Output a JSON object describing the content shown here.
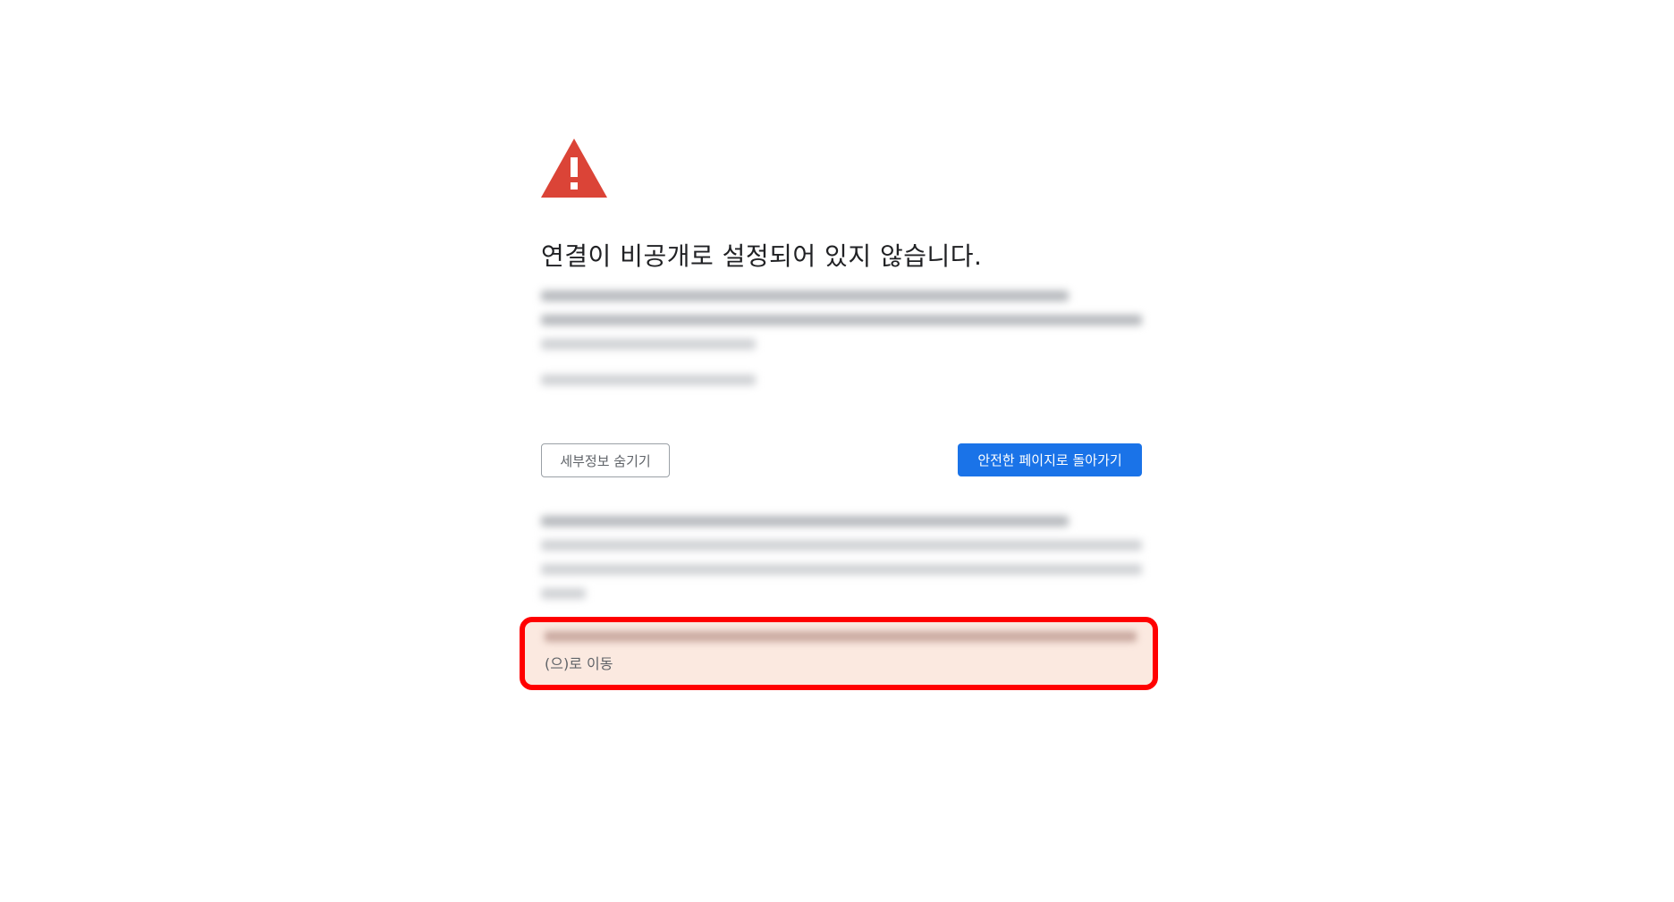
{
  "headline": "연결이 비공개로 설정되어 있지 않습니다.",
  "buttons": {
    "hide_details": "세부정보 숨기기",
    "back_to_safety": "안전한 페이지로 돌아가기"
  },
  "proceed": {
    "suffix": "(으)로 이동"
  },
  "icons": {
    "warning": "warning-triangle-icon"
  },
  "colors": {
    "warning_red": "#db4437",
    "primary_blue": "#1a73e8",
    "highlight_red": "#ff0000"
  }
}
